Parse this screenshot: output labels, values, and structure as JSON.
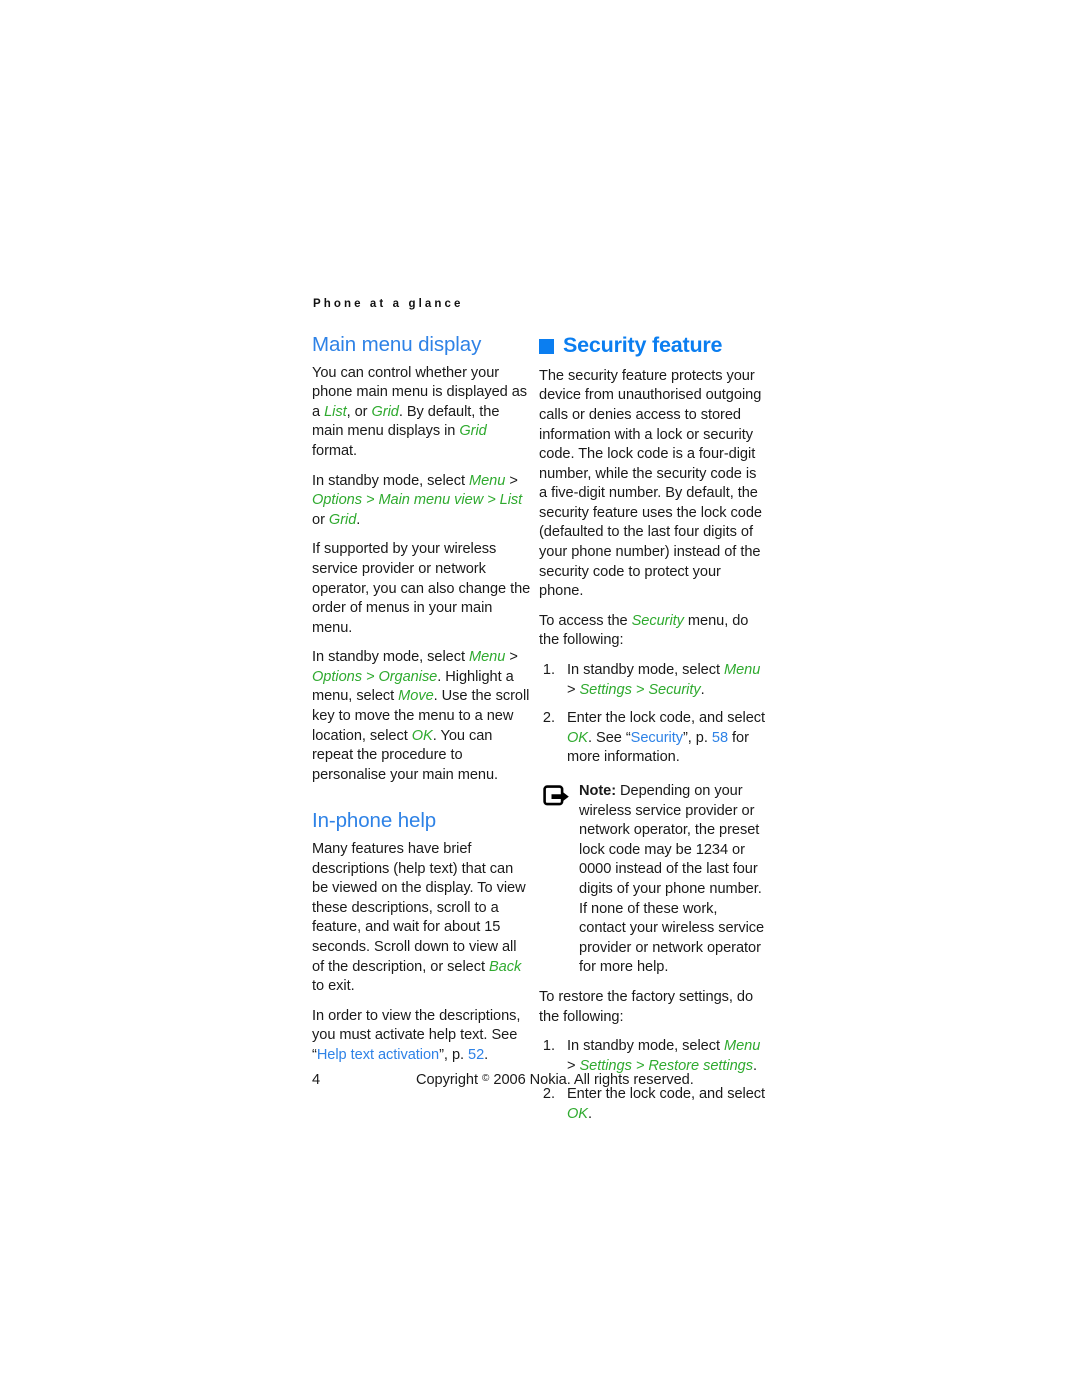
{
  "document": {
    "running_header": "Phone at a glance",
    "page_number": "4",
    "copyright_prefix": "Copyright",
    "copyright_symbol": "©",
    "copyright_suffix": "2006 Nokia. All rights reserved."
  },
  "colors": {
    "heading_blue": "#2e82e6",
    "chapter_blue": "#0b7ef0",
    "ui_green": "#2faa2f",
    "link_blue": "#2e82e6",
    "body_black": "#1a1a1a"
  },
  "left_column": {
    "section1": {
      "heading": "Main menu display",
      "p1_a": "You can control whether your phone main menu is displayed as a ",
      "p1_list": "List",
      "p1_b": ", or ",
      "p1_grid": "Grid",
      "p1_c": ". By default, the main menu displays in ",
      "p1_grid2": "Grid",
      "p1_d": " format.",
      "p2_a": "In standby mode, select ",
      "p2_menu": "Menu",
      "p2_sep1": " > ",
      "p2_options": "Options",
      "p2_sep2": " > ",
      "p2_mainmenuview": "Main menu view",
      "p2_sep3": " > ",
      "p2_list": "List",
      "p2_b": " or ",
      "p2_grid": "Grid",
      "p2_c": ".",
      "p3": "If supported by your wireless service provider or network operator, you can also change the order of menus in your main menu.",
      "p4_a": "In standby mode, select ",
      "p4_menu": "Menu",
      "p4_sep1": " > ",
      "p4_options": "Options",
      "p4_sep2": " > ",
      "p4_organise": "Organise",
      "p4_b": ". Highlight a menu, select ",
      "p4_move": "Move",
      "p4_c": ". Use the scroll key to move the menu to a new location, select ",
      "p4_ok": "OK",
      "p4_d": ". You can repeat the procedure to personalise your main menu."
    },
    "section2": {
      "heading": "In-phone help",
      "p1_a": "Many features have brief descriptions (help text) that can be viewed on the display. To view these descriptions, scroll to a feature, and wait for about 15 seconds. Scroll down to view all of the description, or select ",
      "p1_back": "Back",
      "p1_b": " to exit.",
      "p2_a": "In order to view the descriptions, you must activate help text. See “",
      "p2_link": "Help text activation",
      "p2_b": "”, p. ",
      "p2_page": "52",
      "p2_c": "."
    }
  },
  "right_column": {
    "heading": "Security feature",
    "bullet_icon": "square-bullet-icon",
    "p1": "The security feature protects your device from unauthorised outgoing calls or denies access to stored information with a lock or security code. The lock code is a four-digit number, while the security code is a five-digit number. By default, the security feature uses the lock code (defaulted to the last four digits of your phone number) instead of the security code to protect your phone.",
    "p2_a": "To access the ",
    "p2_security": "Security",
    "p2_b": " menu, do the following:",
    "steps1": [
      {
        "num": "1.",
        "a": "In standby mode, select ",
        "menu": "Menu",
        "sep1": " > ",
        "settings": "Settings",
        "sep2": " > ",
        "security": "Security",
        "b": "."
      },
      {
        "num": "2.",
        "a": "Enter the lock code, and select ",
        "ok": "OK",
        "b": ". See “",
        "link": "Security",
        "c": "”, p. ",
        "page": "58",
        "d": " for more information."
      }
    ],
    "note": {
      "icon": "note-arrow-icon",
      "label": "Note:",
      "text": " Depending on your wireless service provider or network operator, the preset lock code may be 1234 or 0000 instead of the last four digits of your phone number. If none of these work, contact your wireless service provider or network operator for more help."
    },
    "p3": "To restore the factory settings, do the following:",
    "steps2": [
      {
        "num": "1.",
        "a": "In standby mode, select ",
        "menu": "Menu",
        "sep1": " > ",
        "settings": "Settings",
        "sep2": " > ",
        "restore": "Restore settings",
        "b": "."
      },
      {
        "num": "2.",
        "a": "Enter the lock code, and select ",
        "ok": "OK",
        "b": "."
      }
    ]
  }
}
